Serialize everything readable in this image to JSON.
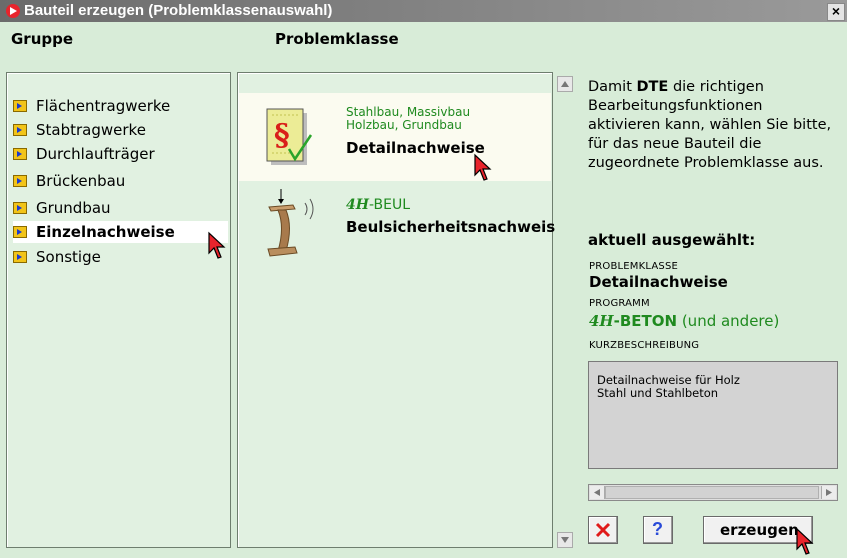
{
  "window": {
    "title": "Bauteil erzeugen (Problemklassenauswahl)",
    "close_label": "×"
  },
  "headers": {
    "gruppe": "Gruppe",
    "problemklasse": "Problemklasse"
  },
  "gruppe": {
    "items": [
      {
        "label": "Flächentragwerke",
        "selected": false
      },
      {
        "label": "Stabtragwerke",
        "selected": false
      },
      {
        "label": "Durchlaufträger",
        "selected": false
      },
      {
        "label": "Brückenbau",
        "selected": false
      },
      {
        "label": "Grundbau",
        "selected": false
      },
      {
        "label": "Einzelnachweise",
        "selected": true
      },
      {
        "label": "Sonstige",
        "selected": false
      }
    ]
  },
  "problemklassen": [
    {
      "line1": "Stahlbau, Massivbau",
      "line2": "Holzbau, Grundbau",
      "title": "Detailnachweise",
      "selected": true
    },
    {
      "logo_prefix": "4H",
      "logo_name": "-BEUL",
      "title": "Beulsicherheitsnachweis",
      "selected": false
    }
  ],
  "info": {
    "text_before": "Damit ",
    "text_bold": "DTE",
    "text_after": " die richtigen Bearbeitungsfunktionen aktivieren kann, wählen Sie bitte, für das neue Bauteil die zugeordnete Problemklasse aus.",
    "selected_heading": "aktuell ausgewählt:",
    "label_problemklasse": "PROBLEMKLASSE",
    "value_problemklasse": "Detailnachweise",
    "label_programm": "PROGRAMM",
    "program_prefix": "4H",
    "program_name": "-BETON",
    "program_suffix": " (und andere)",
    "label_kurz": "KURZBESCHREIBUNG",
    "kurz_line1": "Detailnachweise für Holz",
    "kurz_line2": "Stahl und Stahlbeton"
  },
  "buttons": {
    "create_label": "erzeugen",
    "help_symbol": "?"
  },
  "colors": {
    "accent_green": "#1f8a1f",
    "title_red": "#e8242c",
    "selection_bg": "#ffffff"
  }
}
